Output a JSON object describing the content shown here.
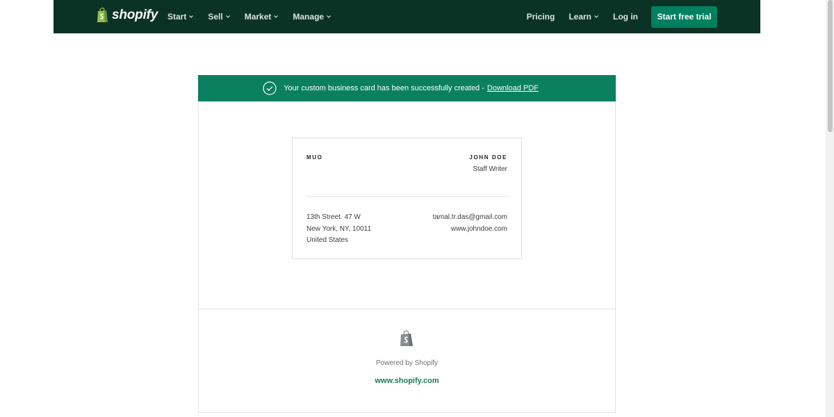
{
  "nav": {
    "logo_text": "shopify",
    "left_items": [
      {
        "label": "Start"
      },
      {
        "label": "Sell"
      },
      {
        "label": "Market"
      },
      {
        "label": "Manage"
      }
    ],
    "pricing": "Pricing",
    "learn": "Learn",
    "login": "Log in",
    "cta": "Start free trial"
  },
  "banner": {
    "message": "Your custom business card has been successfully created -",
    "link": "Download PDF"
  },
  "card": {
    "company": "MUO",
    "name": "JOHN DOE",
    "title": "Staff Writer",
    "address": [
      "13th Street. 47 W",
      "New York, NY, 10011",
      "United States"
    ],
    "email": "tamal.tr.das@gmail.com",
    "website": "www.johndoe.com"
  },
  "footer": {
    "powered": "Powered by Shopify",
    "site": "www.shopify.com"
  },
  "colors": {
    "nav_bg": "#0b3325",
    "accent": "#008060",
    "banner_bg": "#0a8060",
    "link_green": "#1a7a5a"
  }
}
